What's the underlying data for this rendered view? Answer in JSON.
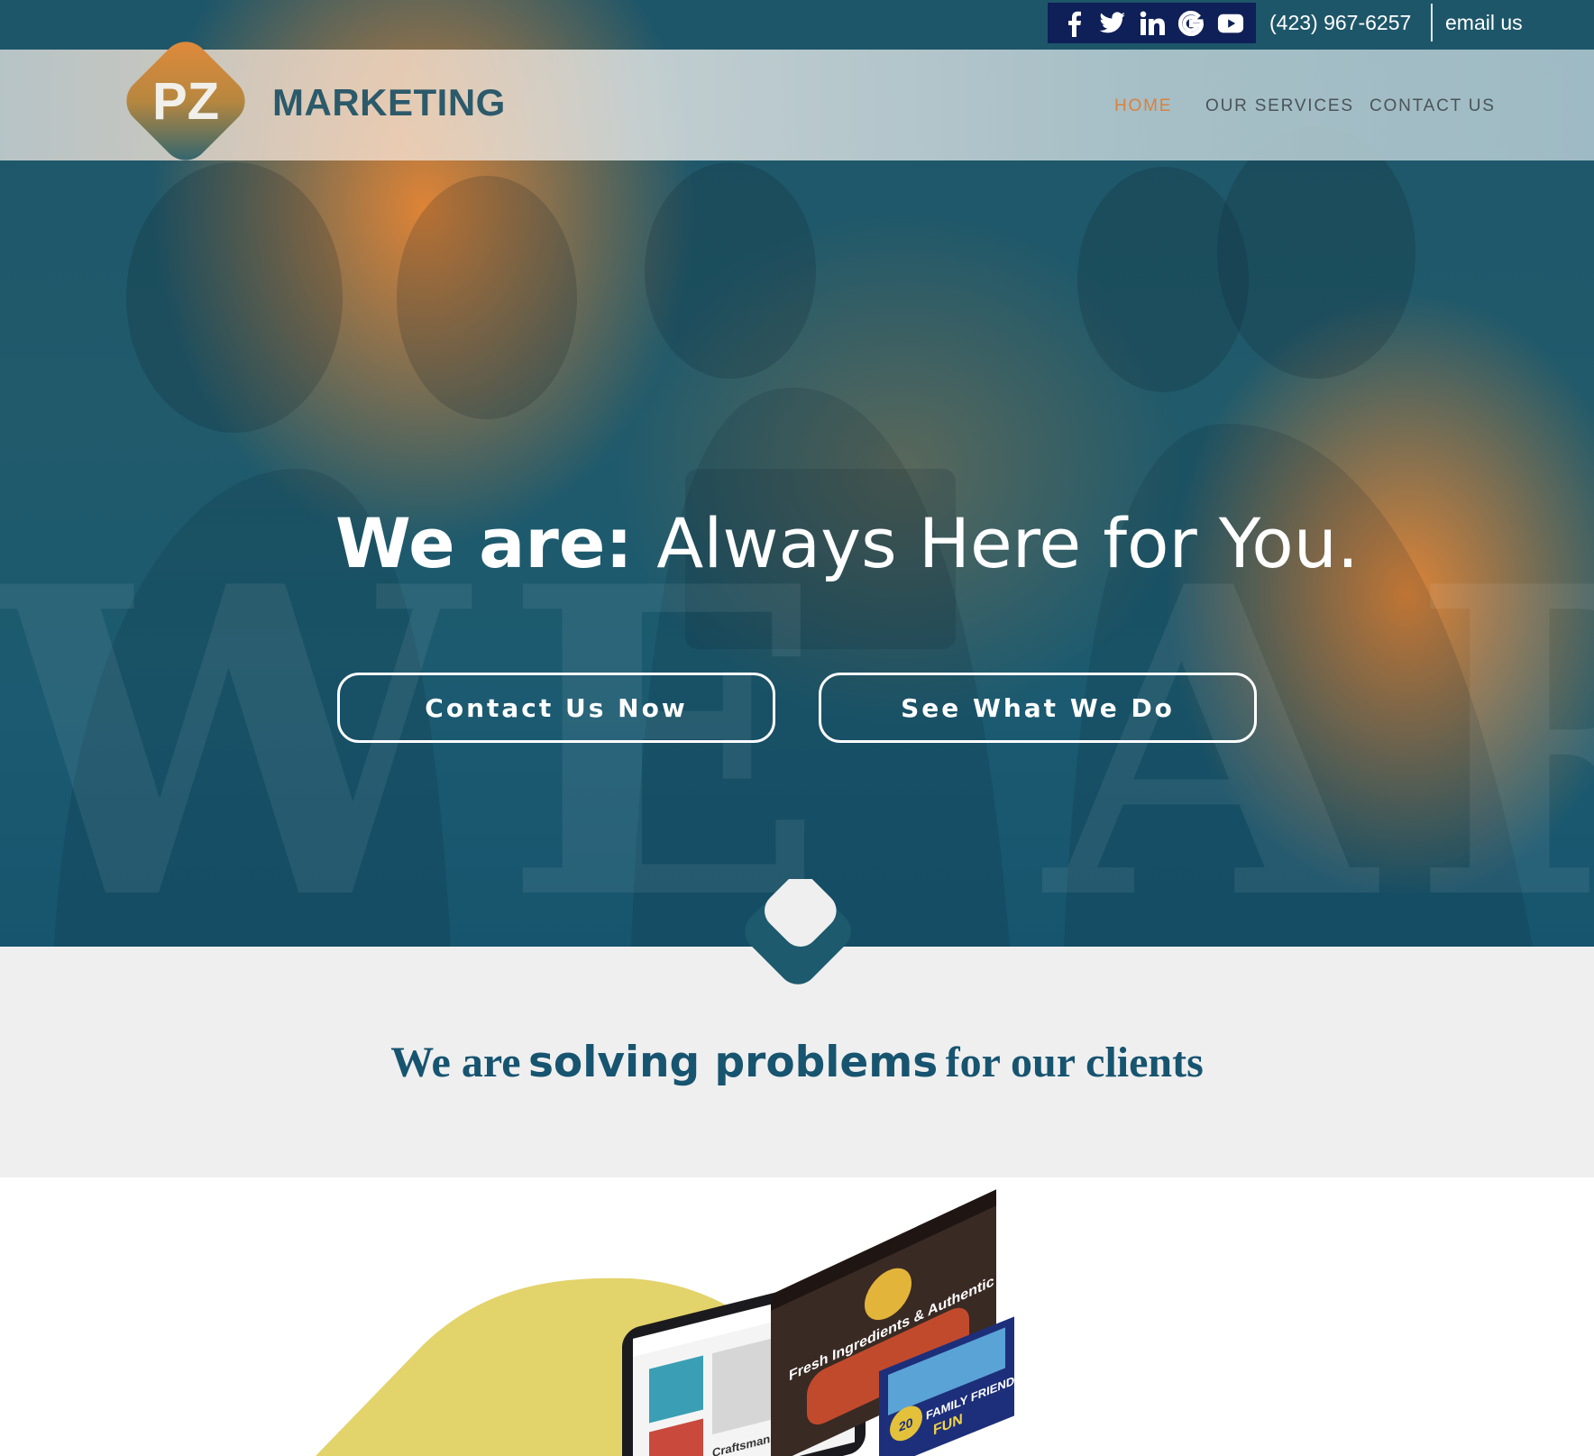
{
  "colors": {
    "accent_orange": "#d9813e",
    "deep_teal": "#175470",
    "social_box": "#0f1f57",
    "band_bg": "#efefef",
    "mustard": "#e3d36b"
  },
  "topbar": {
    "social_icons": [
      "facebook-icon",
      "twitter-icon",
      "linkedin-icon",
      "google-icon",
      "youtube-icon"
    ],
    "phone": "(423) 967-6257",
    "email_label": "email us"
  },
  "header": {
    "logo_mark": "PZ",
    "logo_word": "MARKETING",
    "nav": [
      {
        "label": "HOME",
        "active": true
      },
      {
        "label": "OUR SERVICES",
        "active": false
      },
      {
        "label": "CONTACT US",
        "active": false
      }
    ]
  },
  "hero": {
    "title_strong": "We are:",
    "title_rest": "Always Here for You.",
    "watermark": "WE ARE",
    "buttons": {
      "contact": "Contact Us Now",
      "see": "See What We Do"
    }
  },
  "problems": {
    "part1": "We are",
    "part2": "solving problems",
    "part3": "for our clients"
  },
  "showcase": {
    "screen1_heading": "Craftsmanship & Impr",
    "screen2_heading": "Fresh Ingredients & Authentic Recipes",
    "screen3_heading": "FAMILY FRIENDLY",
    "screen3_sub": "FUN",
    "badge": "20"
  }
}
